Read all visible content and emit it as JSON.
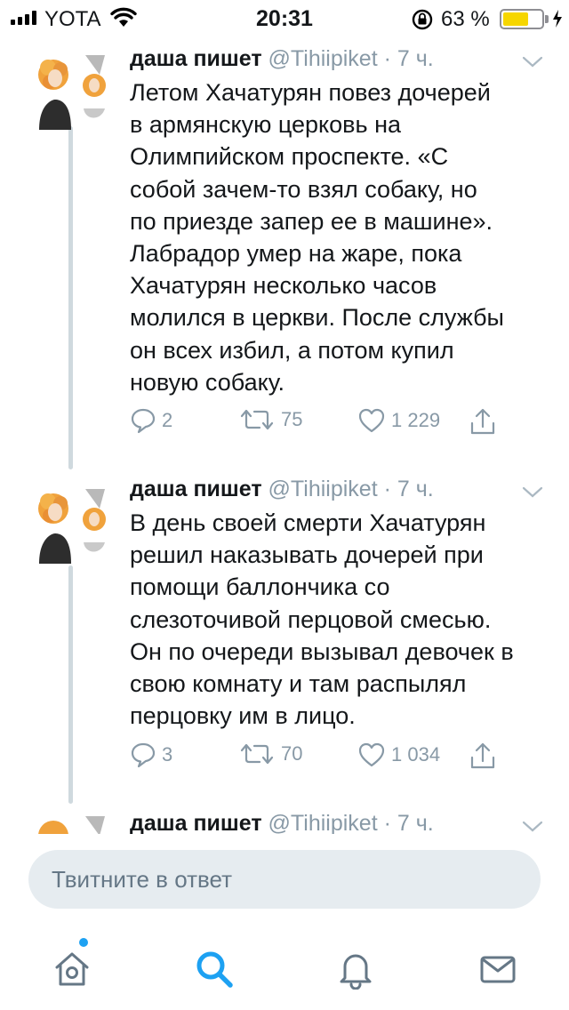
{
  "status_bar": {
    "carrier": "YOTA",
    "time": "20:31",
    "battery_percent": "63 %",
    "battery_level": 0.63,
    "battery_color": "#f6d600"
  },
  "tweets": [
    {
      "author_name": "даша пишет",
      "handle": "@Tihiipiket",
      "time": "· 7 ч.",
      "text_lines": [
        "Летом Хачатурян повез дочерей",
        "в армянскую церковь на",
        "Олимпийском проспекте. «С",
        "собой зачем-то взял собаку, но",
        "по приезде запер ее в машине».",
        "Лабрадор умер на жаре, пока",
        "Хачатурян несколько часов",
        "молился в церкви. После службы",
        "он всех избил, а потом купил",
        "новую собаку."
      ],
      "replies": "2",
      "retweets": "75",
      "likes": "1 229"
    },
    {
      "author_name": "даша пишет",
      "handle": "@Tihiipiket",
      "time": "· 7 ч.",
      "text_lines": [
        "В день своей смерти Хачатурян",
        "решил наказывать дочерей при",
        "помощи баллончика со",
        "слезоточивой перцовой смесью.",
        "Он по очереди вызывал девочек в",
        "свою комнату и там распылял",
        "перцовку им в лицо."
      ],
      "replies": "3",
      "retweets": "70",
      "likes": "1 034"
    },
    {
      "author_name": "даша пишет",
      "handle": "@Tihiipiket",
      "time": "· 7 ч."
    }
  ],
  "reply_bar": {
    "placeholder": "Твитните в ответ"
  },
  "tab_bar": {
    "items": [
      {
        "icon": "home-icon",
        "active": false,
        "has_notification_dot": true
      },
      {
        "icon": "search-icon",
        "active": true
      },
      {
        "icon": "bell-icon",
        "active": false
      },
      {
        "icon": "envelope-icon",
        "active": false
      }
    ],
    "accent_color": "#1da1f2",
    "icon_color": "#657786"
  }
}
